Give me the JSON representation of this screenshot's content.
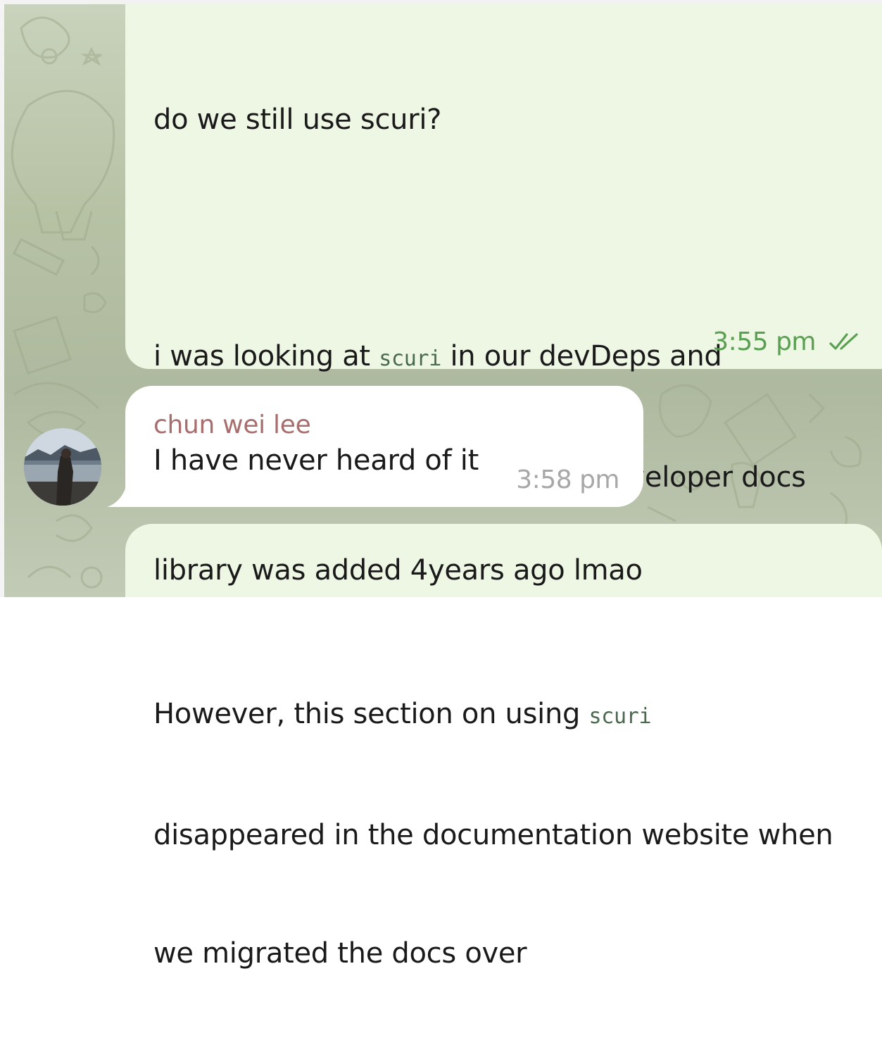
{
  "messages": [
    {
      "direction": "outgoing",
      "lines": [
        {
          "parts": [
            {
              "text": "do we still use scuri?"
            }
          ]
        },
        {
          "parts": [
            {
              "text": ""
            }
          ]
        },
        {
          "parts": [
            {
              "text": "i was looking at "
            },
            {
              "code": "scuri"
            },
            {
              "text": " in our devDeps and"
            }
          ]
        },
        {
          "parts": [
            {
              "text": "realized it was once part of our developer docs"
            }
          ]
        },
        {
          "parts": [
            {
              "text": ""
            }
          ]
        },
        {
          "parts": [
            {
              "text": "However, this section on using "
            },
            {
              "code": "scuri"
            }
          ]
        },
        {
          "parts": [
            {
              "text": "disappeared in the documentation website when"
            }
          ]
        },
        {
          "parts": [
            {
              "text": "we migrated the docs over"
            }
          ]
        }
      ],
      "time": "3:55 pm",
      "status_icon": "double-check-icon"
    },
    {
      "direction": "incoming",
      "sender": "chun wei lee",
      "text": "I have never heard of it",
      "time": "3:58 pm",
      "avatar": "user-avatar"
    },
    {
      "direction": "outgoing",
      "text": "library was added 4years ago lmao"
    }
  ],
  "colors": {
    "outgoing_bubble": "#eef6e4",
    "incoming_bubble": "#ffffff",
    "outgoing_time": "#59a053",
    "incoming_time": "#a7a7a7",
    "sender_name": "#a86e6e",
    "code_text": "#4a6a4e",
    "background": "#b7c2a5"
  }
}
